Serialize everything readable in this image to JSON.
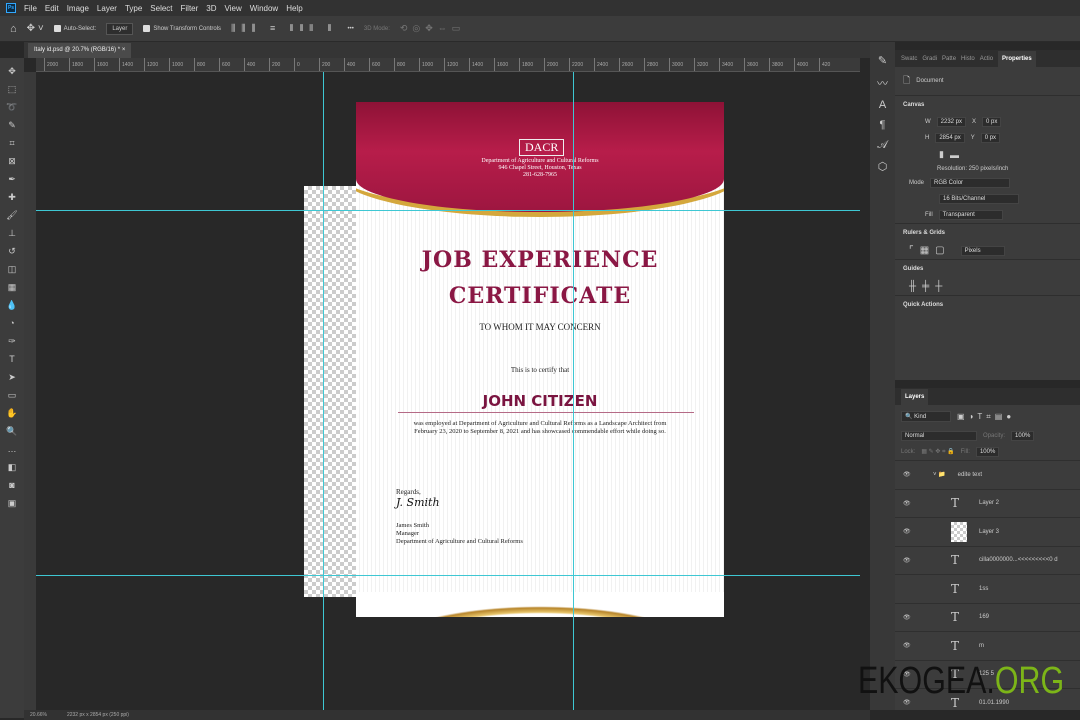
{
  "menu": [
    "File",
    "Edit",
    "Image",
    "Layer",
    "Type",
    "Select",
    "Filter",
    "3D",
    "View",
    "Window",
    "Help"
  ],
  "options": {
    "auto_select": "Auto-Select:",
    "auto_select_value": "Layer",
    "show_transform": "Show Transform Controls",
    "more": "•••",
    "mode_3d": "3D Mode:"
  },
  "tab": {
    "title": "Italy id.psd @ 20.7% (RGB/16) *",
    "close": "×"
  },
  "ruler_ticks": [
    "2000",
    "1800",
    "1600",
    "1400",
    "1200",
    "1000",
    "800",
    "600",
    "400",
    "200",
    "0",
    "200",
    "400",
    "600",
    "800",
    "1000",
    "1200",
    "1400",
    "1600",
    "1800",
    "2000",
    "2200",
    "2400",
    "2600",
    "2800",
    "3000",
    "3200",
    "3400",
    "3600",
    "3800",
    "4000",
    "420"
  ],
  "certificate": {
    "org_abbr": "DACR",
    "org_name": "Department of  Agriculture and Cultural Reforms",
    "address": "946 Chapel Street, Houston, Texas",
    "phone": "281-628-7965",
    "title_line1": "JOB EXPERIENCE",
    "title_line2": "CERTIFICATE",
    "salutation": "TO WHOM IT MAY CONCERN",
    "certify": "This is to certify that",
    "name": "JOHN CITIZEN",
    "body": "was employed at Department of Agriculture and Cultural Reforms as a Landscape Architect from February 23, 2020 to September 8, 2021 and has showcased commendable effort while doing so.",
    "regards": "Regards,",
    "signature": "J. Smith",
    "signer": "James Smith",
    "position": "Manager",
    "department": "Department of Agriculture and Cultural Reforms"
  },
  "properties": {
    "tabs": [
      "Swatc",
      "Gradi",
      "Patte",
      "Histo",
      "Actio",
      "Properties"
    ],
    "document": "Document",
    "canvas": "Canvas",
    "w_label": "W",
    "w": "2232 px",
    "h_label": "H",
    "h": "2854 px",
    "x_label": "X",
    "x": "0 px",
    "y_label": "Y",
    "y": "0 px",
    "resolution": "Resolution: 250 pixels/inch",
    "mode_label": "Mode",
    "mode": "RGB Color",
    "depth": "16 Bits/Channel",
    "fill_label": "Fill",
    "fill": "Transparent",
    "rulers": "Rulers & Grids",
    "units": "Pixels",
    "guides": "Guides",
    "quick": "Quick Actions"
  },
  "layers": {
    "title": "Layers",
    "kind": "Kind",
    "blend": "Normal",
    "opacity_label": "Opacity:",
    "opacity": "100%",
    "lock": "Lock:",
    "fill_label": "Fill:",
    "fill": "100%",
    "items": [
      {
        "name": "edite text",
        "type": "group"
      },
      {
        "name": "Layer 2",
        "type": "text"
      },
      {
        "name": "Layer 3",
        "type": "image"
      },
      {
        "name": "cilla0000000...<<<<<<<<<0 d",
        "type": "text"
      },
      {
        "name": "1ss",
        "type": "text",
        "hidden": true
      },
      {
        "name": "169",
        "type": "text"
      },
      {
        "name": "m",
        "type": "text"
      },
      {
        "name": "125 5",
        "type": "text"
      },
      {
        "name": "01.01.1990",
        "type": "text"
      }
    ]
  },
  "status": {
    "zoom": "20.66%",
    "size": "2232 px x 2854 px (250 ppi)"
  },
  "watermark": {
    "main": "EKOGEA.",
    "accent": "ORG"
  }
}
